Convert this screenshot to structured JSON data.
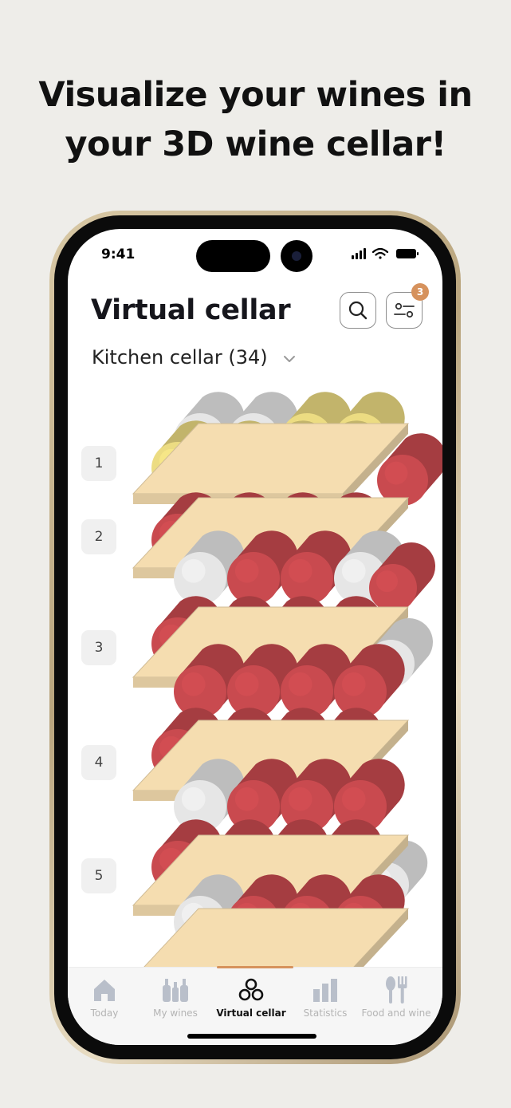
{
  "headline": {
    "line1": "Visualize your wines in",
    "line2": "your 3D wine cellar!"
  },
  "status_bar": {
    "time": "9:41"
  },
  "header": {
    "title": "Virtual cellar",
    "filter_badge": "3"
  },
  "cellar_selector": {
    "value": "Kitchen cellar (34)"
  },
  "shelves": [
    "1",
    "2",
    "3",
    "4",
    "5"
  ],
  "bottle_colors": {
    "red": "#c94a4f",
    "white": "#e6e6e6",
    "sparkling": "#ecdc82",
    "shelf_wood": "#f5ddb0"
  },
  "tabbar": {
    "items": [
      {
        "label": "Today",
        "icon": "home-icon"
      },
      {
        "label": "My wines",
        "icon": "bottles-icon"
      },
      {
        "label": "Virtual cellar",
        "icon": "cellar-icon"
      },
      {
        "label": "Statistics",
        "icon": "bar-chart-icon"
      },
      {
        "label": "Food and wine",
        "icon": "cutlery-icon"
      }
    ],
    "active_index": 2
  }
}
